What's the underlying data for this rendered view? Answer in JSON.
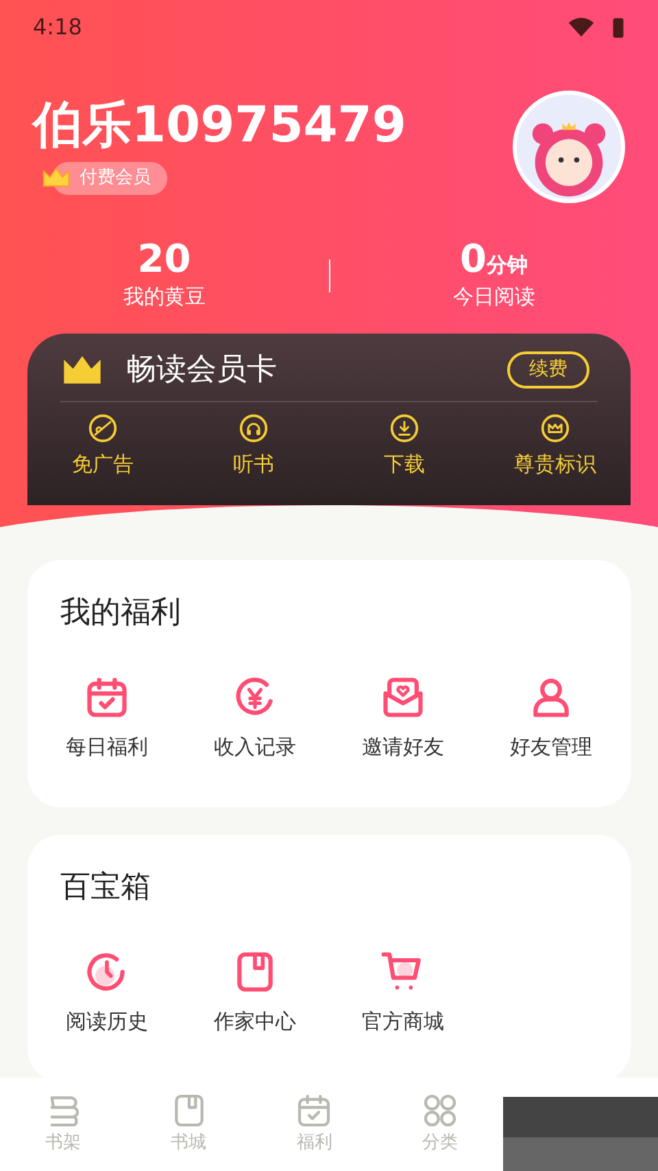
{
  "status_bar": {
    "time": "4:18"
  },
  "profile": {
    "name": "伯乐10975479",
    "badge": "付费会员"
  },
  "stats": [
    {
      "value": "20",
      "label": "我的黄豆"
    },
    {
      "value": "0",
      "unit": "分钟",
      "label": "今日阅读"
    }
  ],
  "vip_card": {
    "title": "畅读会员卡",
    "button": "续费",
    "perks": [
      {
        "kind": "no-ads",
        "label": "免广告"
      },
      {
        "kind": "listen",
        "label": "听书"
      },
      {
        "kind": "download",
        "label": "下载"
      },
      {
        "kind": "crown",
        "label": "尊贵标识"
      }
    ]
  },
  "sections": [
    {
      "title": "我的福利",
      "items": [
        {
          "kind": "calendar",
          "label": "每日福利"
        },
        {
          "kind": "yen",
          "label": "收入记录"
        },
        {
          "kind": "envelope",
          "label": "邀请好友"
        },
        {
          "kind": "person",
          "label": "好友管理"
        }
      ]
    },
    {
      "title": "百宝箱",
      "items": [
        {
          "kind": "clock",
          "label": "阅读历史"
        },
        {
          "kind": "book",
          "label": "作家中心"
        },
        {
          "kind": "cart",
          "label": "官方商城"
        }
      ]
    }
  ],
  "bottom_nav": [
    {
      "kind": "shelf",
      "label": "书架",
      "selected": false
    },
    {
      "kind": "book",
      "label": "书城",
      "selected": false
    },
    {
      "kind": "calendar",
      "label": "福利",
      "selected": false
    },
    {
      "kind": "grid",
      "label": "分类",
      "selected": false
    }
  ]
}
